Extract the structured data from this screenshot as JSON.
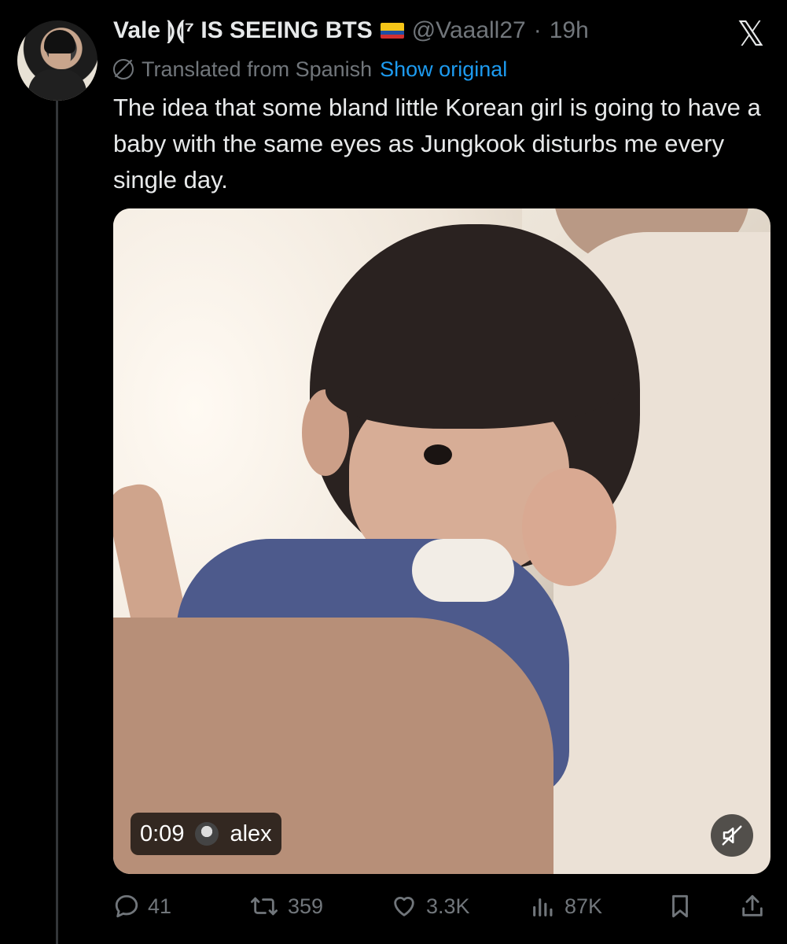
{
  "author": {
    "name": "Vale",
    "name_symbol": "⟭⟬⁷",
    "name_suffix": "IS SEEING BTS",
    "handle": "@Vaaall27",
    "separator": "·",
    "time": "19h"
  },
  "translation": {
    "label": "Translated from Spanish",
    "action": "Show original"
  },
  "tweet": {
    "text": "The idea that some bland little Korean girl is going to have a baby with the same eyes as Jungkook disturbs me every single day."
  },
  "video": {
    "time": "0:09",
    "uploader": "alex"
  },
  "actions": {
    "replies": "41",
    "reposts": "359",
    "likes": "3.3K",
    "views": "87K"
  },
  "icons": {
    "logo": "x-logo-icon",
    "translate": "translate-icon",
    "mute": "mute-icon",
    "reply": "reply-icon",
    "repost": "repost-icon",
    "like": "like-icon",
    "views": "views-icon",
    "bookmark": "bookmark-icon",
    "share": "share-icon"
  },
  "colors": {
    "background": "#000000",
    "text": "#e7e9ea",
    "muted": "#71767b",
    "link": "#1d9bf0"
  }
}
